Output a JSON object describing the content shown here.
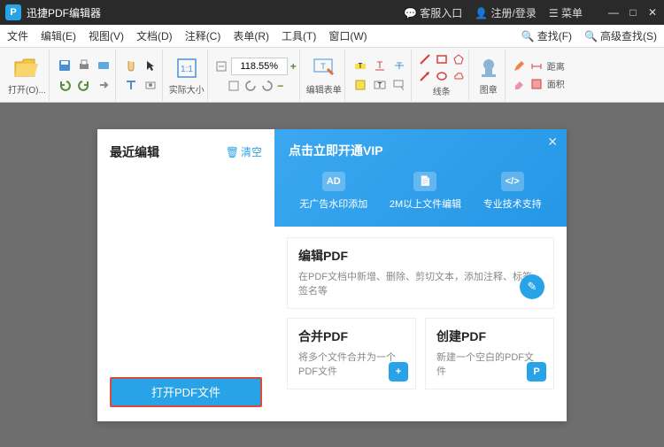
{
  "titlebar": {
    "app_name": "迅捷PDF编辑器",
    "service": "客服入口",
    "login": "注册/登录",
    "menu": "菜单"
  },
  "menubar": {
    "items": [
      "文件",
      "编辑(E)",
      "视图(V)",
      "文档(D)",
      "注释(C)",
      "表单(R)",
      "工具(T)",
      "窗口(W)"
    ],
    "search": "查找(F)",
    "adv_search": "高级查找(S)"
  },
  "toolbar": {
    "open_label": "打开(O)...",
    "zoom_value": "118.55%",
    "fit_label": "实际大小",
    "edit_form_label": "编辑表单",
    "lines_label": "线条",
    "image_label": "图章",
    "distance_label": "距离",
    "area_label": "面积"
  },
  "welcome": {
    "recent_title": "最近编辑",
    "clear_label": "清空",
    "open_btn_label": "打开PDF文件",
    "vip": {
      "title": "点击立即开通VIP",
      "feat1": "无广告水印添加",
      "feat2": "2M以上文件编辑",
      "feat3": "专业技术支持"
    },
    "edit_card": {
      "title": "编辑PDF",
      "desc": "在PDF文档中新增、删除、剪切文本，添加注释、标签、签名等"
    },
    "merge_card": {
      "title": "合并PDF",
      "desc": "将多个文件合并为一个PDF文件"
    },
    "create_card": {
      "title": "创建PDF",
      "desc": "新建一个空白的PDF文件"
    }
  }
}
